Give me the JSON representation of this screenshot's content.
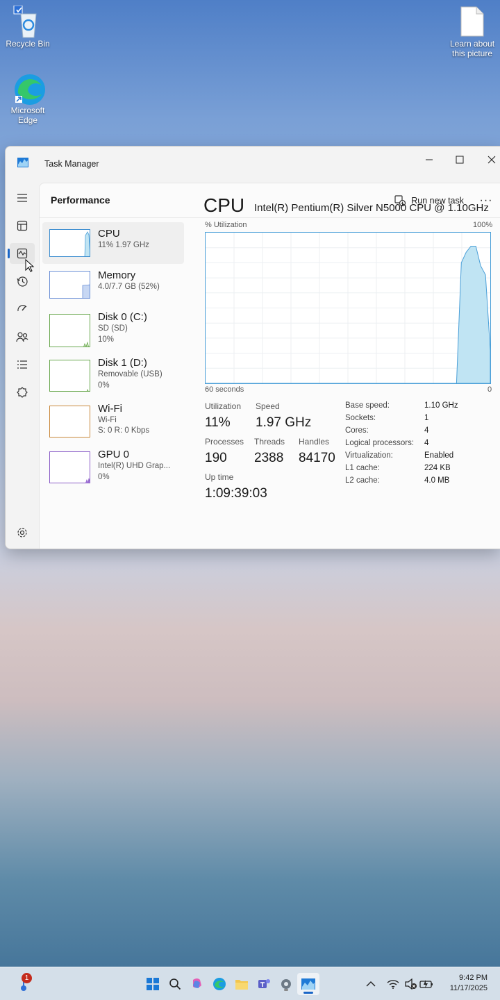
{
  "desktop": {
    "icons": [
      {
        "label": "Recycle Bin",
        "icon": "recycle-bin-icon"
      },
      {
        "label": "Microsoft Edge",
        "icon": "edge-icon"
      },
      {
        "label": "Learn about this picture",
        "icon": "document-icon"
      }
    ]
  },
  "window": {
    "title": "Task Manager",
    "controls": {
      "minimize": "minimize-icon",
      "maximize": "maximize-icon",
      "close": "close-icon"
    }
  },
  "nav": {
    "items": [
      "menu-icon",
      "processes-icon",
      "performance-icon",
      "app-history-icon",
      "startup-apps-icon",
      "users-icon",
      "details-icon",
      "services-icon",
      "settings-icon"
    ],
    "active": "performance-icon"
  },
  "header": {
    "page_title": "Performance",
    "run_new_task": "Run new task",
    "more": "···"
  },
  "devices": [
    {
      "name": "CPU",
      "lines": [
        "11% 1.97 GHz"
      ],
      "selected": true
    },
    {
      "name": "Memory",
      "lines": [
        "4.0/7.7 GB (52%)"
      ]
    },
    {
      "name": "Disk 0 (C:)",
      "lines": [
        "SD (SD)",
        "10%"
      ]
    },
    {
      "name": "Disk 1 (D:)",
      "lines": [
        "Removable (USB)",
        "0%"
      ]
    },
    {
      "name": "Wi-Fi",
      "lines": [
        "Wi-Fi",
        "S: 0 R: 0 Kbps"
      ]
    },
    {
      "name": "GPU 0",
      "lines": [
        "Intel(R) UHD Grap...",
        "0%"
      ]
    }
  ],
  "detail": {
    "title": "CPU",
    "model": "Intel(R) Pentium(R) Silver N5000 CPU @ 1.10GHz",
    "graph_label_left": "% Utilization",
    "graph_label_right": "100%",
    "graph_bottom_left": "60 seconds",
    "graph_bottom_right": "0",
    "utilization_label": "Utilization",
    "utilization": "11%",
    "speed_label": "Speed",
    "speed": "1.97 GHz",
    "processes_label": "Processes",
    "processes": "190",
    "threads_label": "Threads",
    "threads": "2388",
    "handles_label": "Handles",
    "handles": "84170",
    "uptime_label": "Up time",
    "uptime": "1:09:39:03",
    "specs": [
      {
        "label": "Base speed:",
        "value": "1.10 GHz"
      },
      {
        "label": "Sockets:",
        "value": "1"
      },
      {
        "label": "Cores:",
        "value": "4"
      },
      {
        "label": "Logical processors:",
        "value": "4"
      },
      {
        "label": "Virtualization:",
        "value": "Enabled"
      },
      {
        "label": "L1 cache:",
        "value": "224 KB"
      },
      {
        "label": "L2 cache:",
        "value": "4.0 MB"
      }
    ],
    "cpu_history_percent": [
      0,
      0,
      0,
      0,
      0,
      0,
      0,
      0,
      0,
      0,
      0,
      0,
      0,
      0,
      0,
      0,
      0,
      0,
      0,
      0,
      0,
      0,
      0,
      0,
      0,
      0,
      0,
      0,
      0,
      0,
      0,
      0,
      0,
      0,
      0,
      0,
      0,
      0,
      0,
      0,
      0,
      0,
      0,
      0,
      0,
      0,
      0,
      0,
      0,
      0,
      0,
      0,
      0,
      80,
      87,
      91,
      91,
      78,
      72,
      22
    ]
  },
  "taskbar": {
    "notification_count": "1",
    "apps": [
      "start-icon",
      "search-icon",
      "copilot-icon",
      "edge-icon",
      "file-explorer-icon",
      "teams-icon",
      "settings-icon",
      "task-manager-icon"
    ],
    "tray": [
      "chevron-up-icon",
      "wifi-icon",
      "volume-muted-icon",
      "battery-icon"
    ],
    "time": "9:42 PM",
    "date": "11/17/2025"
  },
  "colors": {
    "accent": "#1a66c7",
    "cpu_fill": "#c0e4f3",
    "cpu_line": "#4a9fd8"
  }
}
